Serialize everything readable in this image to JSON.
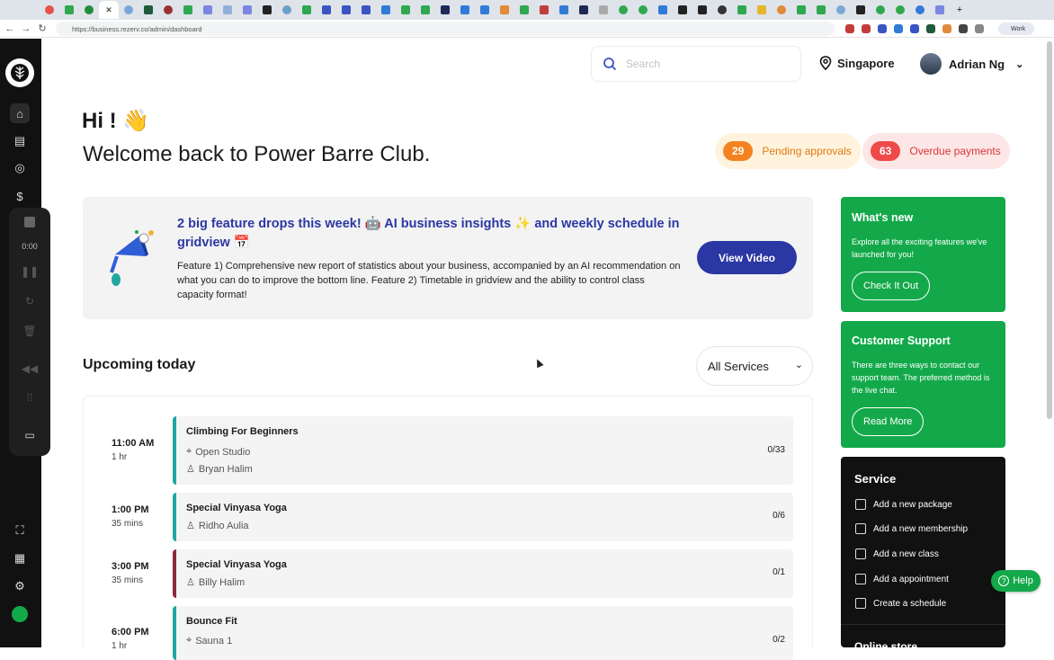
{
  "browser": {
    "url": "https://business.rezerv.co/admin/dashboard",
    "profile": "Work"
  },
  "header": {
    "search_placeholder": "Search",
    "location": "Singapore",
    "user_name": "Adrian Ng"
  },
  "greeting": {
    "hi": "Hi ! 👋",
    "welcome": "Welcome back to Power Barre Club."
  },
  "badges": [
    {
      "count": "29",
      "label": "Pending approvals",
      "color": "#f58220",
      "bg": "#fff3dd"
    },
    {
      "count": "63",
      "label": "Overdue payments",
      "color": "#ef4a4a",
      "bg": "#fde6e6"
    }
  ],
  "recorder": {
    "time": "0:00"
  },
  "feature": {
    "title": "2 big feature drops this week! 🤖 AI business insights ✨ and weekly schedule in gridview 📅",
    "description": "Feature 1) Comprehensive new report of statistics about your business, accompanied by an AI recommendation on what you can do to improve the bottom line. Feature 2) Timetable in gridview and the ability to control class capacity format!",
    "button": "View Video"
  },
  "whats_new": {
    "title": "What's new",
    "text": "Explore all the exciting features we've launched for you!",
    "button": "Check It Out"
  },
  "support": {
    "title": "Customer Support",
    "text": "There are three ways to contact our support team. The preferred method is the live chat.",
    "button": "Read More"
  },
  "service": {
    "title": "Service",
    "items": [
      "Add a new package",
      "Add a new membership",
      "Add a new class",
      "Add a appointment",
      "Create a schedule"
    ],
    "next_section": "Online store"
  },
  "help": "Help",
  "upcoming": {
    "title": "Upcoming today",
    "filter": "All Services",
    "sessions": [
      {
        "time": "11:00 AM",
        "duration": "1 hr",
        "name": "Climbing For Beginners",
        "location": "Open Studio",
        "instructor": "Bryan Halim",
        "capacity": "0/33",
        "color": "#1fa7a0"
      },
      {
        "time": "1:00 PM",
        "duration": "35 mins",
        "name": "Special Vinyasa Yoga",
        "location": "",
        "instructor": "Ridho Aulia",
        "capacity": "0/6",
        "color": "#1fa7a0"
      },
      {
        "time": "3:00 PM",
        "duration": "35 mins",
        "name": "Special Vinyasa Yoga",
        "location": "",
        "instructor": "Billy Halim",
        "capacity": "0/1",
        "color": "#8b2b3b"
      },
      {
        "time": "6:00 PM",
        "duration": "1 hr",
        "name": "Bounce Fit",
        "location": "Sauna 1",
        "instructor": "",
        "capacity": "0/2",
        "color": "#1fa7a0"
      }
    ]
  }
}
